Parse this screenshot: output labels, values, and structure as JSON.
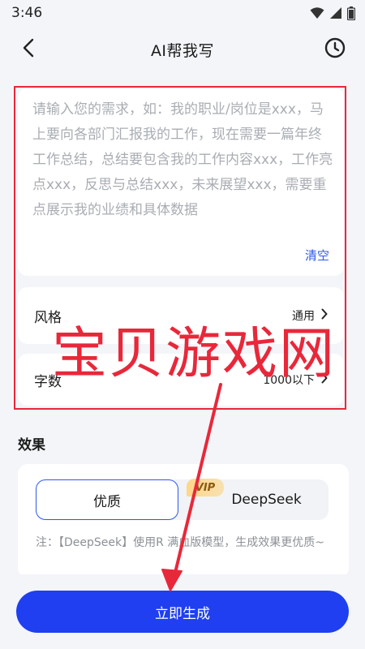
{
  "status_bar": {
    "time": "3:46",
    "icons": [
      "wifi-icon",
      "cellular-signal-icon",
      "battery-icon"
    ]
  },
  "header": {
    "title": "AI帮我写",
    "back_icon": "chevron-left-icon",
    "history_icon": "clock-icon"
  },
  "prompt": {
    "value": "",
    "placeholder": "请输入您的需求，如：我的职业/岗位是xxx，马上要向各部门汇报我的工作，现在需要一篇年终工作总结，总结要包含我的工作内容xxx，工作亮点xxx，反思与总结xxx，未来展望xxx，需要重点展示我的业绩和具体数据",
    "clear_label": "清空"
  },
  "options": {
    "style": {
      "label": "风格",
      "value": "通用"
    },
    "words": {
      "label": "字数",
      "value": "1000以下"
    }
  },
  "effect": {
    "title": "效果",
    "choices": [
      {
        "label": "优质",
        "selected": true
      },
      {
        "label": "DeepSeek",
        "badge": "VIP",
        "selected": false
      }
    ],
    "note": "注：【DeepSeek】使用R 满血版模型，生成效果更优质~"
  },
  "footer": {
    "generate_label": "立即生成"
  },
  "overlay": {
    "watermark": "宝贝游戏网"
  },
  "colors": {
    "accent": "#1f3ff0",
    "link": "#2c58ea",
    "annotation": "#e8283a",
    "background": "#f3f5f9"
  }
}
